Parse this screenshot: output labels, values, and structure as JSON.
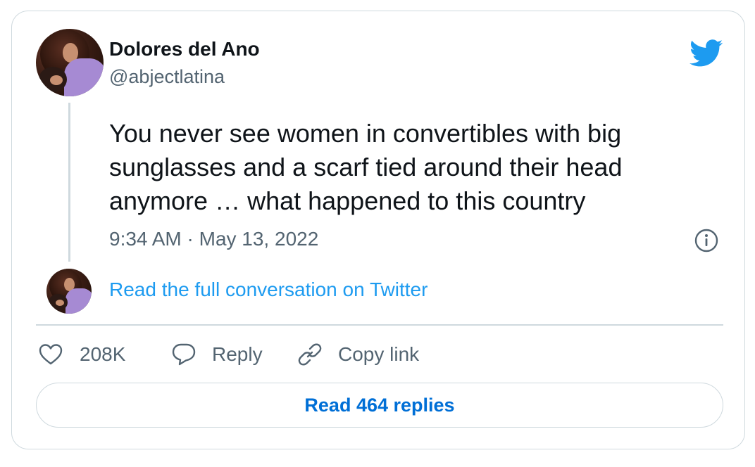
{
  "author": {
    "display_name": "Dolores del Ano",
    "handle": "@abjectlatina"
  },
  "tweet": {
    "text": "You never see women in convertibles with big sunglasses and a scarf tied around their head anymore … what happened to this country",
    "timestamp": "9:34 AM · May 13, 2022"
  },
  "conversation": {
    "link_label": "Read the full conversation on Twitter"
  },
  "actions": {
    "likes": "208K",
    "reply_label": "Reply",
    "copy_link_label": "Copy link"
  },
  "footer": {
    "read_replies_label": "Read 464 replies"
  },
  "icons": {
    "brand": "twitter-bird-icon",
    "info": "info-icon",
    "like": "heart-icon",
    "reply": "speech-bubble-icon",
    "copy": "link-icon"
  },
  "colors": {
    "brand_blue": "#1d9bf0",
    "text_primary": "#0f1419",
    "text_secondary": "#536471",
    "border": "#cfd9de",
    "button_text": "#006fd6"
  }
}
